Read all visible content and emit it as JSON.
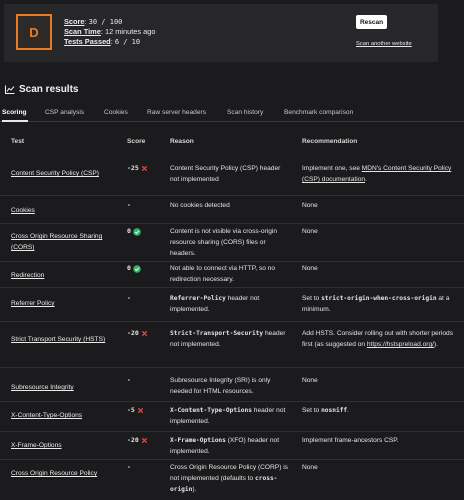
{
  "summary": {
    "grade": "D",
    "score_label": "Score",
    "score_value": "30 / 100",
    "scan_time_label": "Scan Time",
    "scan_time_value": "12 minutes ago",
    "tests_passed_label": "Tests Passed",
    "tests_passed_value": "6 / 10",
    "rescan_label": "Rescan",
    "scan_another_label": "Scan another website",
    "grade_color": "#e87c26"
  },
  "section": {
    "title": "Scan results",
    "icon": "bar-chart-icon"
  },
  "tabs": [
    {
      "label": "Scoring",
      "active": true
    },
    {
      "label": "CSP analysis"
    },
    {
      "label": "Cookies"
    },
    {
      "label": "Raw server headers"
    },
    {
      "label": "Scan history"
    },
    {
      "label": "Benchmark comparison"
    }
  ],
  "table": {
    "headers": {
      "test": "Test",
      "score": "Score",
      "reason": "Reason",
      "recommendation": "Recommendation"
    },
    "rows": [
      {
        "test": "Content Security Policy (CSP)",
        "score": "-25",
        "status": "fail",
        "reason": "Content Security Policy (CSP) header not implemented",
        "rec_a": "Implement one, see ",
        "rec_link": "MDN's Content Security Policy (CSP) documentation",
        "rec_b": "."
      },
      {
        "test": "Cookies",
        "score": "-",
        "status": "none",
        "reason": "No cookies detected",
        "rec": "None"
      },
      {
        "test": "Cross Origin Resource Sharing (CORS)",
        "score": "0",
        "status": "pass",
        "reason": "Content is not visible via cross-origin resource sharing (CORS) files or headers.",
        "rec": "None"
      },
      {
        "test": "Redirection",
        "score": "0",
        "status": "pass",
        "reason": "Not able to connect via HTTP, so no redirection necessary.",
        "rec": "None"
      },
      {
        "test": "Referrer Policy",
        "score": "-",
        "status": "none",
        "reason_code": "Referrer-Policy",
        "reason_rest": " header not implemented.",
        "rec_a": "Set to ",
        "rec_code": "strict-origin-when-cross-origin",
        "rec_b": " at a minimum."
      },
      {
        "test": "Strict Transport Security (HSTS)",
        "score": "-20",
        "status": "fail",
        "reason_code": "Strict-Transport-Security",
        "reason_rest": " header not implemented.",
        "rec_a": "Add HSTS. Consider rolling out with shorter periods first (as suggested on ",
        "rec_link": "https://hstspreload.org/",
        "rec_b": ")."
      },
      {
        "test": "Subresource Integrity",
        "score": "-",
        "status": "none",
        "reason": "Subresource Integrity (SRI) is only needed for HTML resources.",
        "rec": "None"
      },
      {
        "test": "X-Content-Type-Options",
        "score": "-5",
        "status": "fail",
        "reason_code": "X-Content-Type-Options",
        "reason_rest": " header not implemented.",
        "rec_a": "Set to ",
        "rec_code": "nosniff",
        "rec_b": "."
      },
      {
        "test": "X-Frame-Options",
        "score": "-20",
        "status": "fail",
        "reason_code": "X-Frame-Options",
        "reason_rest": " (XFO) header not implemented.",
        "rec": "Implement frame-ancestors CSP."
      },
      {
        "test": "Cross Origin Resource Policy",
        "score": "-",
        "status": "none",
        "reason_a": "Cross Origin Resource Policy (CORP) is not implemented (defaults to ",
        "reason_code": "cross-origin",
        "reason_b": ").",
        "rec": "None"
      }
    ]
  },
  "colors": {
    "fail": "#e04848",
    "pass": "#2fb765",
    "background": "#1b1b1d"
  }
}
